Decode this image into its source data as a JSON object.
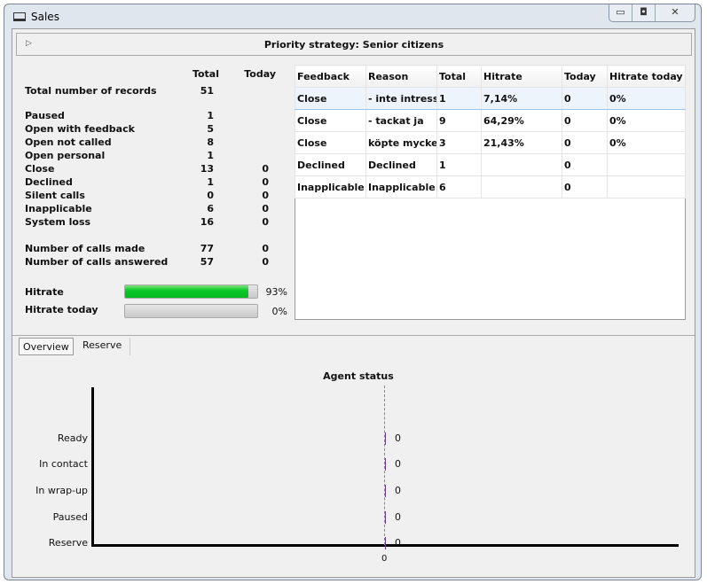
{
  "window": {
    "title": "Sales",
    "controls": [
      "minimize",
      "restore",
      "close"
    ]
  },
  "header": {
    "title": "Priority strategy: Senior citizens"
  },
  "stats": {
    "col_total": "Total",
    "col_today": "Today",
    "rows": [
      {
        "label": "Total number of records",
        "total": "51",
        "today": ""
      },
      {
        "label": "Paused",
        "total": "1",
        "today": ""
      },
      {
        "label": "Open with feedback",
        "total": "5",
        "today": ""
      },
      {
        "label": "Open not called",
        "total": "8",
        "today": ""
      },
      {
        "label": "Open personal",
        "total": "1",
        "today": ""
      },
      {
        "label": "Close",
        "total": "13",
        "today": "0"
      },
      {
        "label": "Declined",
        "total": "1",
        "today": "0"
      },
      {
        "label": "Silent calls",
        "total": "0",
        "today": "0"
      },
      {
        "label": "Inapplicable",
        "total": "6",
        "today": "0"
      },
      {
        "label": "System loss",
        "total": "16",
        "today": "0"
      },
      {
        "label": "Number of calls made",
        "total": "77",
        "today": "0"
      },
      {
        "label": "Number of calls answered",
        "total": "57",
        "today": "0"
      }
    ],
    "hitrate": {
      "label": "Hitrate",
      "value": 93,
      "text": "93%"
    },
    "hitrate_today": {
      "label": "Hitrate today",
      "value": 0,
      "text": "0%"
    }
  },
  "table": {
    "columns": [
      "Feedback",
      "Reason",
      "Total",
      "Hitrate",
      "Today",
      "Hitrate today"
    ],
    "rows": [
      [
        "Close",
        "- inte intresse",
        "1",
        "7,14%",
        "0",
        "0%"
      ],
      [
        "Close",
        "- tackat ja",
        "9",
        "64,29%",
        "0",
        "0%"
      ],
      [
        "Close",
        "köpte mycket",
        "3",
        "21,43%",
        "0",
        "0%"
      ],
      [
        "Declined",
        "Declined",
        "1",
        "",
        "0",
        ""
      ],
      [
        "Inapplicable",
        "Inapplicable",
        "6",
        "",
        "0",
        ""
      ]
    ]
  },
  "tabs": [
    {
      "label": "Overview",
      "active": true
    },
    {
      "label": "Reserve",
      "active": false
    }
  ],
  "chart_data": {
    "type": "bar",
    "title": "Agent status",
    "categories": [
      "Ready",
      "In contact",
      "In wrap-up",
      "Paused",
      "Reserve"
    ],
    "values": [
      0,
      0,
      0,
      0,
      0
    ],
    "value_labels": [
      "0",
      "0",
      "0",
      "0",
      "0"
    ],
    "x_ticks": [
      "0"
    ],
    "orientation": "horizontal",
    "bar_color": "#6a3a9a"
  }
}
